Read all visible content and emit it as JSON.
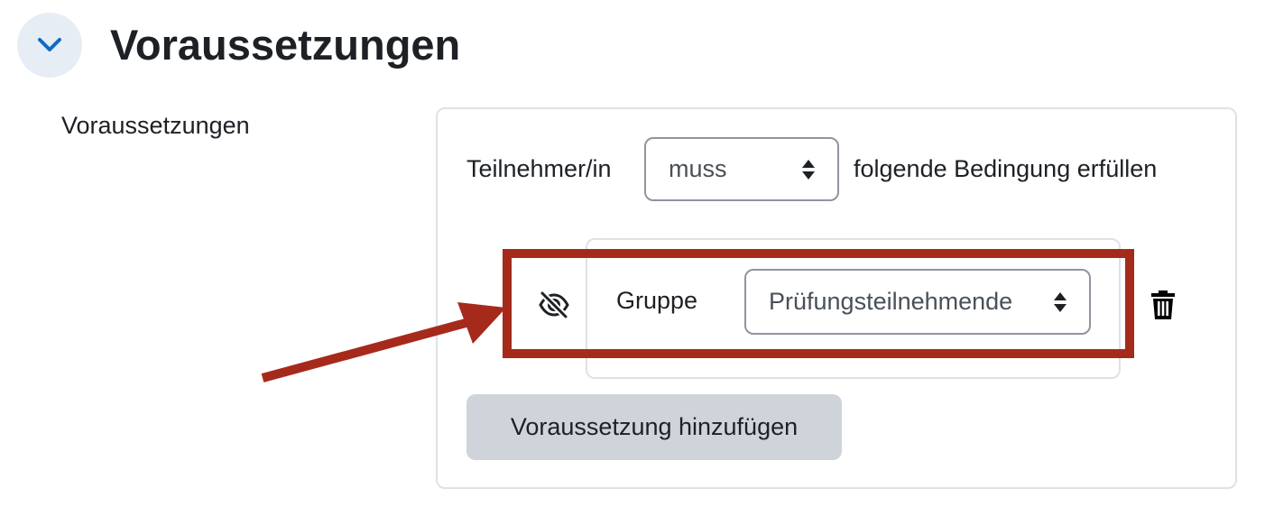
{
  "section": {
    "title": "Voraussetzungen",
    "collapse_icon": "chevron-down-icon"
  },
  "field": {
    "label": "Voraussetzungen"
  },
  "restriction": {
    "prefix": "Teilnehmer/in",
    "must_select": {
      "value": "muss"
    },
    "suffix": "folgende Bedingung erfüllen"
  },
  "condition": {
    "visibility_icon": "eye-slash-icon",
    "type_label": "Gruppe",
    "group_select": {
      "value": "Prüfungsteilnehmende"
    },
    "delete_icon": "trash-icon"
  },
  "add_button": {
    "label": "Voraussetzung hinzufügen"
  },
  "annotation": {
    "color": "#a62a1b"
  },
  "colors": {
    "accent": "#0f6cbf",
    "text": "#1d2125",
    "button_bg": "#ced4da"
  }
}
